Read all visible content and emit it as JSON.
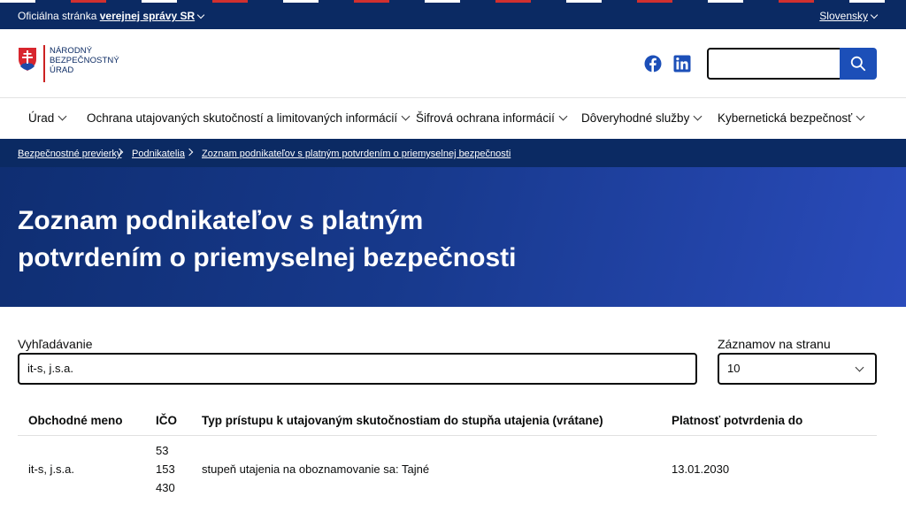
{
  "topbar": {
    "official_prefix": "Oficiálna stránka",
    "official_link": "verejnej správy SR",
    "language": "Slovensky"
  },
  "logo": {
    "line1": "NÁRODNÝ",
    "line2": "BEZPEČNOSTNÝ",
    "line3": "ÚRAD"
  },
  "nav": {
    "items": [
      {
        "label": "Úrad"
      },
      {
        "label": "Ochrana utajovaných skutočností a limitovaných informácií"
      },
      {
        "label": "Šifrová ochrana informácií"
      },
      {
        "label": "Dôveryhodné služby"
      },
      {
        "label": "Kybernetická bezpečnosť"
      }
    ]
  },
  "breadcrumb": {
    "items": [
      {
        "label": "Bezpečnostné previerky"
      },
      {
        "label": "Podnikatelia"
      },
      {
        "label": "Zoznam podnikateľov s platným potvrdením o priemyselnej bezpečnosti"
      }
    ]
  },
  "hero": {
    "title_line1": "Zoznam podnikateľov s platným",
    "title_line2": "potvrdením o priemyselnej bezpečnosti"
  },
  "filters": {
    "search_label": "Vyhľadávanie",
    "search_value": "it-s, j.s.a.",
    "page_size_label": "Záznamov na stranu",
    "page_size_value": "10"
  },
  "table": {
    "headers": {
      "name": "Obchodné meno",
      "ico": "IČO",
      "access": "Typ prístupu k utajovaným skutočnostiam do stupňa utajenia (vrátane)",
      "validity": "Platnosť potvrdenia do"
    },
    "rows": [
      {
        "name": "it-s, j.s.a.",
        "ico_line1": "53",
        "ico_line2": "153",
        "ico_line3": "430",
        "access": "stupeň utajenia na oboznamovanie sa: Tajné",
        "validity": "13.01.2030"
      }
    ]
  },
  "colors": {
    "navy": "#0b2a63",
    "accent_blue": "#1c4fb8",
    "hero_end": "#2a4bbb"
  }
}
